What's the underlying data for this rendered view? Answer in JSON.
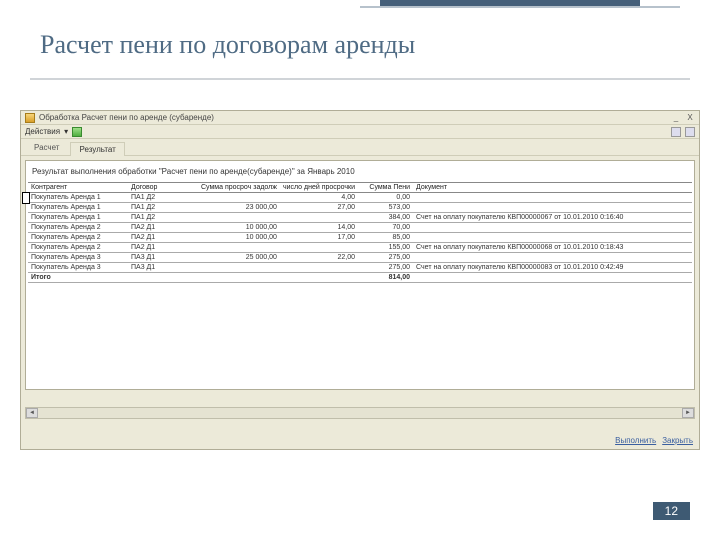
{
  "slide": {
    "title": "Расчет пени по договорам аренды",
    "page": "12"
  },
  "app": {
    "title": "Обработка  Расчет пени по аренде (субаренде)",
    "menu": {
      "actions": "Действия"
    },
    "tabs": {
      "calc": "Расчет",
      "result": "Результат"
    },
    "report_title": "Результат выполнения обработки \"Расчет пени по аренде(субаренде)\" за   Январь 2010",
    "columns": {
      "c1": "Контрагент",
      "c2": "Договор",
      "c3": "Сумма просроч задолж",
      "c4": "число дней просрочки",
      "c5": "Сумма Пени",
      "c6": "Документ"
    },
    "rows": [
      {
        "c1": "Покупатель Аренда 1",
        "c2": "ПА1 Д2",
        "c3": "",
        "c4": "4,00",
        "c5": "0,00",
        "c6": ""
      },
      {
        "c1": "Покупатель Аренда 1",
        "c2": "ПА1 Д2",
        "c3": "23 000,00",
        "c4": "27,00",
        "c5": "573,00",
        "c6": ""
      },
      {
        "c1": "Покупатель Аренда 1",
        "c2": "ПА1 Д2",
        "c3": "",
        "c4": "",
        "c5": "384,00",
        "c6": "Счет на оплату покупателю КВП00000067 от 10.01.2010 0:16:40"
      },
      {
        "c1": "Покупатель Аренда 2",
        "c2": "ПА2 Д1",
        "c3": "10 000,00",
        "c4": "14,00",
        "c5": "70,00",
        "c6": ""
      },
      {
        "c1": "Покупатель Аренда 2",
        "c2": "ПА2 Д1",
        "c3": "10 000,00",
        "c4": "17,00",
        "c5": "85,00",
        "c6": ""
      },
      {
        "c1": "Покупатель Аренда 2",
        "c2": "ПА2 Д1",
        "c3": "",
        "c4": "",
        "c5": "155,00",
        "c6": "Счет на оплату покупателю КВП00000068 от 10.01.2010 0:18:43"
      },
      {
        "c1": "Покупатель Аренда 3",
        "c2": "ПА3 Д1",
        "c3": "25 000,00",
        "c4": "22,00",
        "c5": "275,00",
        "c6": ""
      },
      {
        "c1": "Покупатель Аренда 3",
        "c2": "ПА3 Д1",
        "c3": "",
        "c4": "",
        "c5": "275,00",
        "c6": "Счет на оплату покупателю КВП00000083 от 10.01.2010 0:42:49"
      }
    ],
    "total": {
      "label": "Итого",
      "sum": "814,00"
    },
    "footer": {
      "run": "Выполнить",
      "close": "Закрыть"
    },
    "icons": {
      "min": "_",
      "close": "X",
      "dd": "▾",
      "l": "◄",
      "r": "►"
    }
  }
}
